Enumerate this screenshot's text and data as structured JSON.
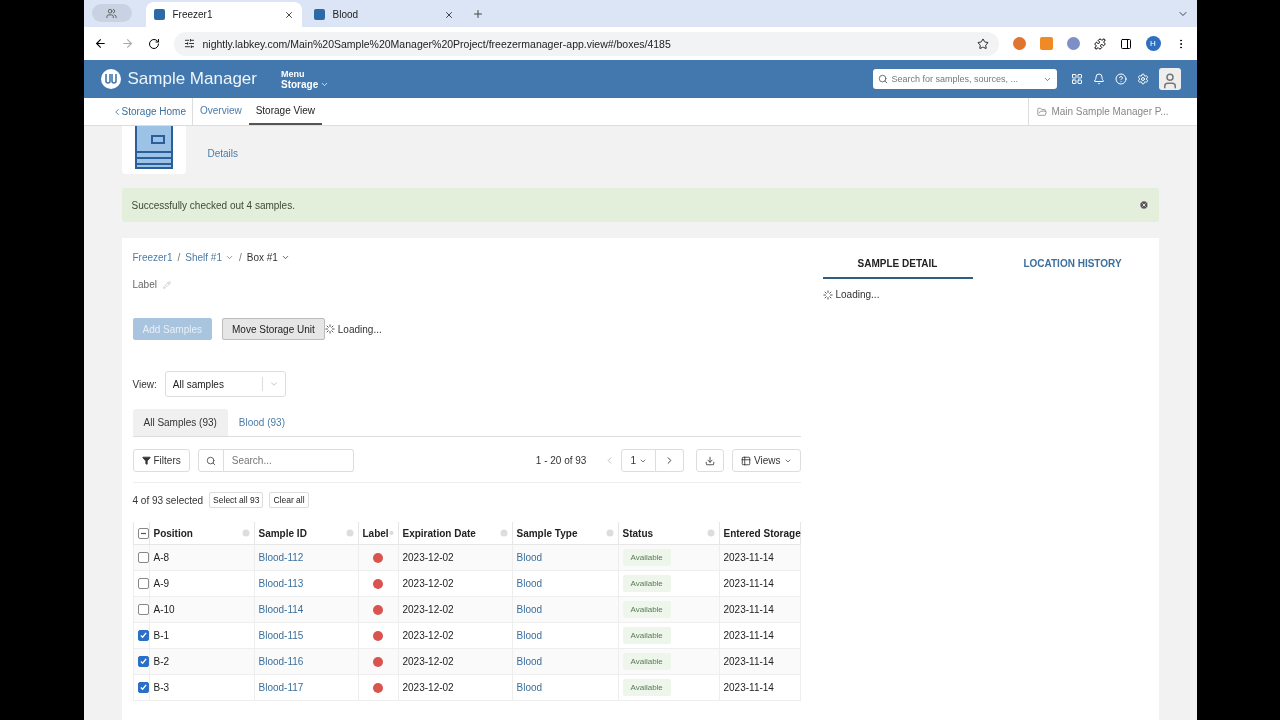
{
  "browser": {
    "tabs": [
      {
        "title": "Freezer1",
        "selected": true
      },
      {
        "title": "Blood",
        "selected": false
      }
    ],
    "url": "nightly.labkey.com/Main%20Sample%20Manager%20Project/freezermanager-app.view#/boxes/4185",
    "profile_initial": "H"
  },
  "app_bar": {
    "brand": "Sample Manager",
    "menu_label": "Menu",
    "menu_value": "Storage",
    "search": {
      "placeholder": "Search for samples, sources, ..."
    }
  },
  "sub_nav": {
    "back": "Storage Home",
    "items": [
      {
        "label": "Overview",
        "selected": false
      },
      {
        "label": "Storage View",
        "selected": true
      }
    ],
    "project": "Main Sample Manager P..."
  },
  "header": {
    "details_link": "Details"
  },
  "alert": {
    "message": "Successfully checked out 4 samples."
  },
  "breadcrumb": {
    "separator": "/",
    "items": [
      {
        "label": "Freezer1",
        "menu": false,
        "current": false
      },
      {
        "label": "Shelf #1",
        "menu": true,
        "current": false
      },
      {
        "label": "Box #1",
        "menu": true,
        "current": true
      }
    ]
  },
  "label_field": "Label",
  "actions": [
    {
      "label": "Add Samples",
      "disabled": true
    },
    {
      "label": "Move Storage Unit",
      "disabled": false
    }
  ],
  "actions_loading": "Loading...",
  "view": {
    "label": "View:",
    "value": "All samples"
  },
  "sample_tabs": [
    {
      "label": "All Samples (93)",
      "selected": true
    },
    {
      "label": "Blood (93)",
      "selected": false
    }
  ],
  "grid_toolbar": {
    "filters": "Filters",
    "search_placeholder": "Search...",
    "range": "1 - 20 of 93",
    "page": "1",
    "views": "Views"
  },
  "selection": {
    "summary": "4 of 93 selected",
    "select_all": "Select all 93",
    "clear_all": "Clear all"
  },
  "table": {
    "select_all": {
      "indeterminate": true
    },
    "columns": [
      "Position",
      "Sample ID",
      "Label",
      "Expiration Date",
      "Sample Type",
      "Status",
      "Entered Storage"
    ],
    "rows": [
      {
        "checked": false,
        "position": "A-8",
        "sample_id": "Blood-112",
        "color": "#d9534f",
        "expiration": "2023-12-02",
        "type": "Blood",
        "status": "Available",
        "entered": "2023-11-14"
      },
      {
        "checked": false,
        "position": "A-9",
        "sample_id": "Blood-113",
        "color": "#d9534f",
        "expiration": "2023-12-02",
        "type": "Blood",
        "status": "Available",
        "entered": "2023-11-14"
      },
      {
        "checked": false,
        "position": "A-10",
        "sample_id": "Blood-114",
        "color": "#d9534f",
        "expiration": "2023-12-02",
        "type": "Blood",
        "status": "Available",
        "entered": "2023-11-14"
      },
      {
        "checked": true,
        "position": "B-1",
        "sample_id": "Blood-115",
        "color": "#d9534f",
        "expiration": "2023-12-02",
        "type": "Blood",
        "status": "Available",
        "entered": "2023-11-14"
      },
      {
        "checked": true,
        "position": "B-2",
        "sample_id": "Blood-116",
        "color": "#d9534f",
        "expiration": "2023-12-02",
        "type": "Blood",
        "status": "Available",
        "entered": "2023-11-14"
      },
      {
        "checked": true,
        "position": "B-3",
        "sample_id": "Blood-117",
        "color": "#d9534f",
        "expiration": "2023-12-02",
        "type": "Blood",
        "status": "Available",
        "entered": "2023-11-14"
      }
    ]
  },
  "detail_tabs": [
    {
      "label": "SAMPLE DETAIL",
      "selected": true
    },
    {
      "label": "LOCATION HISTORY",
      "selected": false
    }
  ],
  "detail_loading": "Loading..."
}
